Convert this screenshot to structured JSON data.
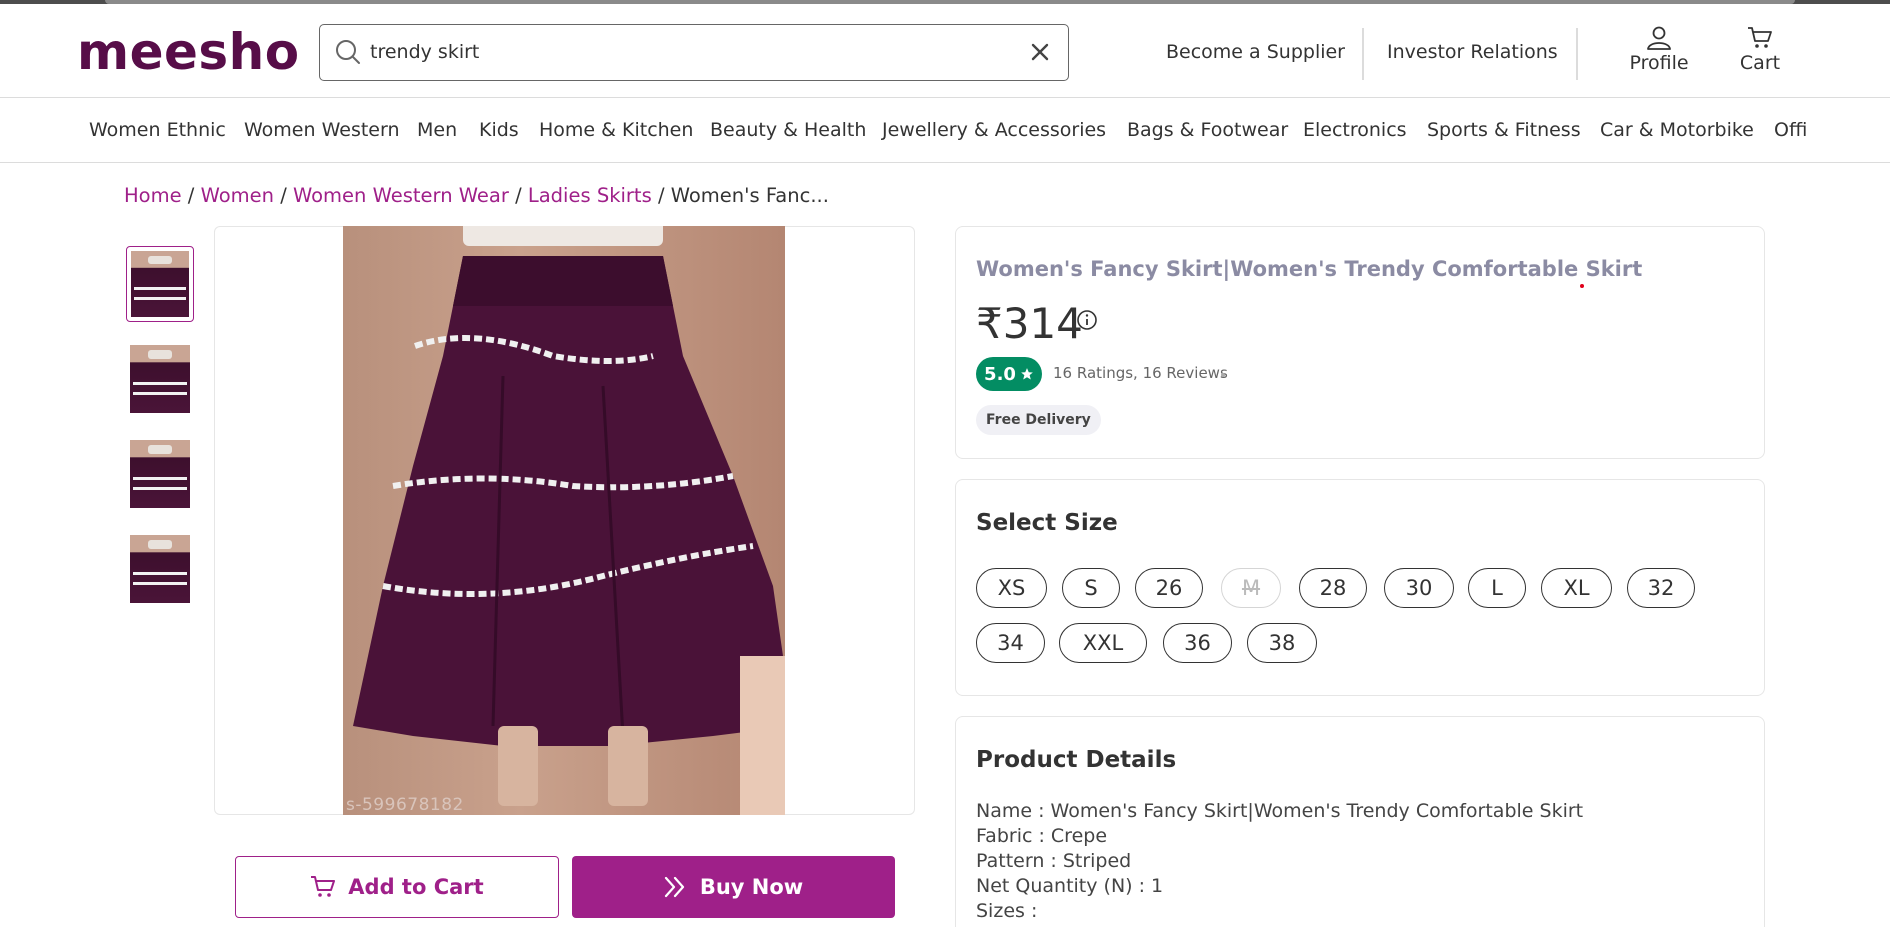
{
  "header": {
    "logo": "meesho",
    "search_value": "trendy skirt",
    "become_supplier": "Become a Supplier",
    "investor_relations": "Investor Relations",
    "profile_label": "Profile",
    "cart_label": "Cart"
  },
  "categories": [
    "Women Ethnic",
    "Women Western",
    "Men",
    "Kids",
    "Home & Kitchen",
    "Beauty & Health",
    "Jewellery & Accessories",
    "Bags & Footwear",
    "Electronics",
    "Sports & Fitness",
    "Car & Motorbike",
    "Offi"
  ],
  "breadcrumb": {
    "home": "Home",
    "women": "Women",
    "western": "Women Western Wear",
    "skirts": "Ladies Skirts",
    "current": "Women's Fanc...",
    "sep": "/"
  },
  "image": {
    "watermark": "s-599678182"
  },
  "actions": {
    "add_to_cart": "Add to Cart",
    "buy_now": "Buy Now"
  },
  "product": {
    "name": "Women's Fancy Skirt|Women's Trendy Comfortable Skirt",
    "price": "₹314",
    "rating": "5.0",
    "ratings_text": "16 Ratings, 16 Reviews",
    "free_delivery": "Free Delivery"
  },
  "sizes": {
    "title": "Select Size",
    "options": [
      "XS",
      "S",
      "26",
      "M",
      "28",
      "30",
      "L",
      "XL",
      "32",
      "34",
      "XXL",
      "36",
      "38"
    ],
    "unavailable": [
      "M"
    ]
  },
  "details": {
    "title": "Product Details",
    "lines": [
      "Name : Women's Fancy Skirt|Women's Trendy Comfortable Skirt",
      "Fabric : Crepe",
      "Pattern : Striped",
      "Net Quantity (N) : 1",
      "Sizes :"
    ]
  },
  "colors": {
    "brand": "#9f2089",
    "logo": "#570d48",
    "rating_green": "#038d63"
  }
}
